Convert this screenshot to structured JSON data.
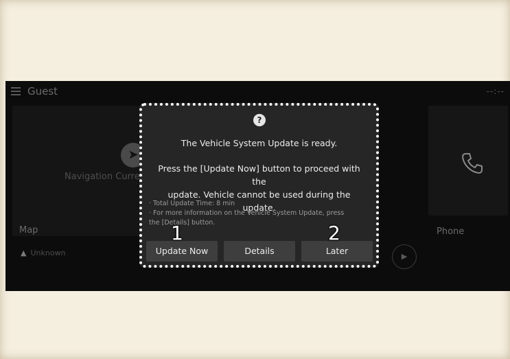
{
  "header": {
    "user": "Guest",
    "clock": "--:--"
  },
  "home": {
    "navigation_text": "Navigation Curre",
    "map_label": "Map",
    "unknown_text": "Unknown",
    "phone_label": "Phone"
  },
  "dialog": {
    "icon": "question-icon",
    "title": "The Vehicle System Update is ready.",
    "body_line1": "Press the [Update Now] button to proceed with the",
    "body_line2": "update. Vehicle cannot be used during the update.",
    "note1": "· Total Update Time: 8 min",
    "note2": "· For more information on the Vehicle System Update, press",
    "note3": "the [Details] button.",
    "buttons": {
      "update_now": "Update Now",
      "details": "Details",
      "later": "Later"
    }
  },
  "callouts": {
    "one": "1",
    "two": "2"
  },
  "colors": {
    "dialog_bg": "#262626",
    "screen_bg": "#0c0c0c",
    "page_bg": "#f5efe0",
    "button_bg": "#3e3e3e"
  }
}
